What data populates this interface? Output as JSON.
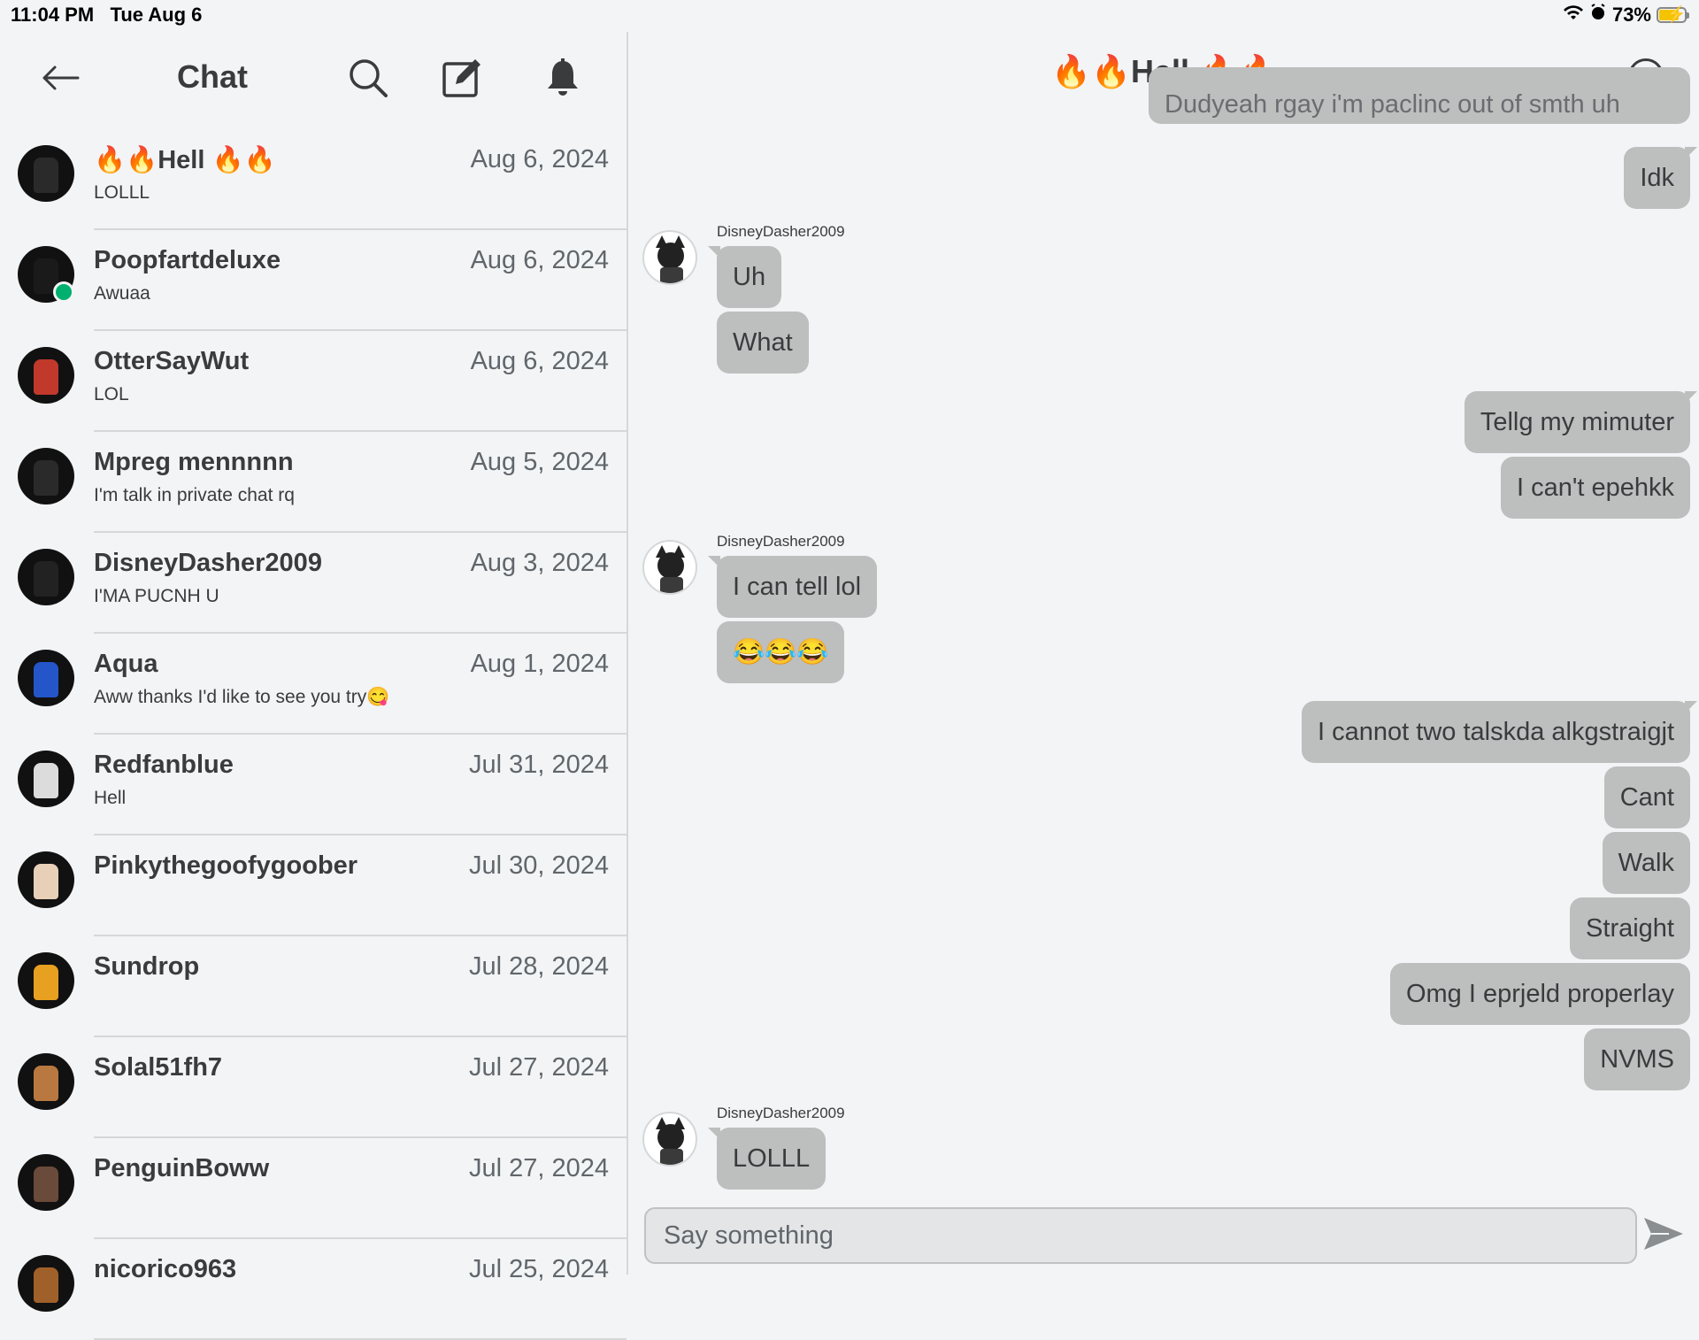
{
  "status_bar": {
    "time": "11:04 PM",
    "date": "Tue Aug 6",
    "battery": "73%"
  },
  "left_header": {
    "title": "Chat"
  },
  "chats": [
    {
      "name": "🔥🔥Hell 🔥🔥",
      "preview": "LOLLL",
      "date": "Aug 6, 2024",
      "online": false,
      "avatar_color": "#2a2a2a"
    },
    {
      "name": "Poopfartdeluxe",
      "preview": "Awuaa",
      "date": "Aug 6, 2024",
      "online": true,
      "avatar_color": "#1a1a1a"
    },
    {
      "name": "OtterSayWut",
      "preview": "LOL",
      "date": "Aug 6, 2024",
      "online": false,
      "avatar_color": "#c0392b"
    },
    {
      "name": "Mpreg mennnnn",
      "preview": "I'm talk in private chat rq",
      "date": "Aug 5, 2024",
      "online": false,
      "avatar_color": "#2a2a2a"
    },
    {
      "name": "DisneyDasher2009",
      "preview": "I'MA PUCNH U",
      "date": "Aug 3, 2024",
      "online": false,
      "avatar_color": "#222222"
    },
    {
      "name": "Aqua",
      "preview": "Aww thanks I'd like to see you try😋",
      "date": "Aug 1, 2024",
      "online": false,
      "avatar_color": "#2456c9"
    },
    {
      "name": "Redfanblue",
      "preview": "Hell",
      "date": "Jul 31, 2024",
      "online": false,
      "avatar_color": "#dcdcdc"
    },
    {
      "name": "Pinkythegoofygoober",
      "preview": "",
      "date": "Jul 30, 2024",
      "online": false,
      "avatar_color": "#e8d0b8"
    },
    {
      "name": "Sundrop",
      "preview": "",
      "date": "Jul 28, 2024",
      "online": false,
      "avatar_color": "#e8a020"
    },
    {
      "name": "Solal51fh7",
      "preview": "",
      "date": "Jul 27, 2024",
      "online": false,
      "avatar_color": "#b87840"
    },
    {
      "name": "PenguinBoww",
      "preview": "",
      "date": "Jul 27, 2024",
      "online": false,
      "avatar_color": "#6a4a3a"
    },
    {
      "name": "nicorico963",
      "preview": "",
      "date": "Jul 25, 2024",
      "online": false,
      "avatar_color": "#a0602a"
    }
  ],
  "conversation": {
    "title": "🔥🔥Hell 🔥🔥",
    "partial_top_message": "Dudyeah rgay i'm paclinc out of smth uh",
    "messages": [
      {
        "text": "Idk",
        "dir": "out"
      },
      {
        "sender": "DisneyDasher2009"
      },
      {
        "text": "Uh",
        "dir": "in"
      },
      {
        "text": "What",
        "dir": "in"
      },
      {
        "text": "Tellg my mimuter",
        "dir": "out"
      },
      {
        "text": "I can't epehkk",
        "dir": "out"
      },
      {
        "sender": "DisneyDasher2009"
      },
      {
        "text": "I can tell lol",
        "dir": "in"
      },
      {
        "text": "😂😂😂",
        "dir": "in"
      },
      {
        "text": "I cannot two talskda alkgstraigjt",
        "dir": "out"
      },
      {
        "text": "Cant",
        "dir": "out"
      },
      {
        "text": "Walk",
        "dir": "out"
      },
      {
        "text": "Straight",
        "dir": "out"
      },
      {
        "text": "Omg I eprjeld properlay",
        "dir": "out"
      },
      {
        "text": "NVMS",
        "dir": "out"
      },
      {
        "sender": "DisneyDasher2009"
      },
      {
        "text": "LOLLL",
        "dir": "in"
      }
    ],
    "composer_placeholder": "Say something"
  }
}
